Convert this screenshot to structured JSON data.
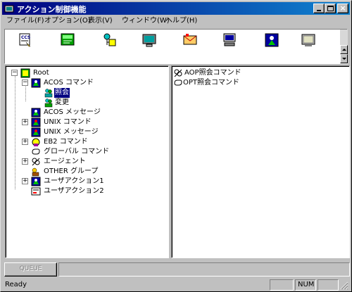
{
  "window": {
    "title": "アクション制御機能"
  },
  "menu": [
    {
      "label": "ファイル(F)",
      "icon": "menu-file"
    },
    {
      "label": "オプション(O)",
      "icon": "menu-option"
    },
    {
      "label": "表示(V)",
      "icon": "menu-view"
    },
    {
      "label": "ウィンドウ(W)",
      "icon": "menu-window"
    },
    {
      "label": "ヘルプ(H)",
      "icon": "menu-help"
    }
  ],
  "toolbar": {
    "icons": [
      "ccs-icon",
      "terminal-icon",
      "flowchart-icon",
      "monitor-icon",
      "mail-icon",
      "network-icon",
      "agent-icon",
      "display-icon"
    ]
  },
  "tree": {
    "root": "Root",
    "acos_command": "ACOS コマンド",
    "inquiry": "照会",
    "change": "変更",
    "acos_message": "ACOS メッセージ",
    "unix_command": "UNIX コマンド",
    "unix_message": "UNIX メッセージ",
    "eb2_command": "EB2 コマンド",
    "global_command": "グローバル コマンド",
    "agent": "エージェント",
    "other_group": "OTHER グループ",
    "user_action1": "ユーザアクション1",
    "user_action2": "ユーザアクション2"
  },
  "list": {
    "items": [
      "AOP照会コマンド",
      "OPT照会コマンド"
    ]
  },
  "queue": {
    "label": "QUEUE"
  },
  "status": {
    "text": "Ready",
    "num": "NUM"
  },
  "colors": {
    "title_bar": "#000080",
    "selection": "#000080",
    "chrome": "#c0c0c0"
  }
}
